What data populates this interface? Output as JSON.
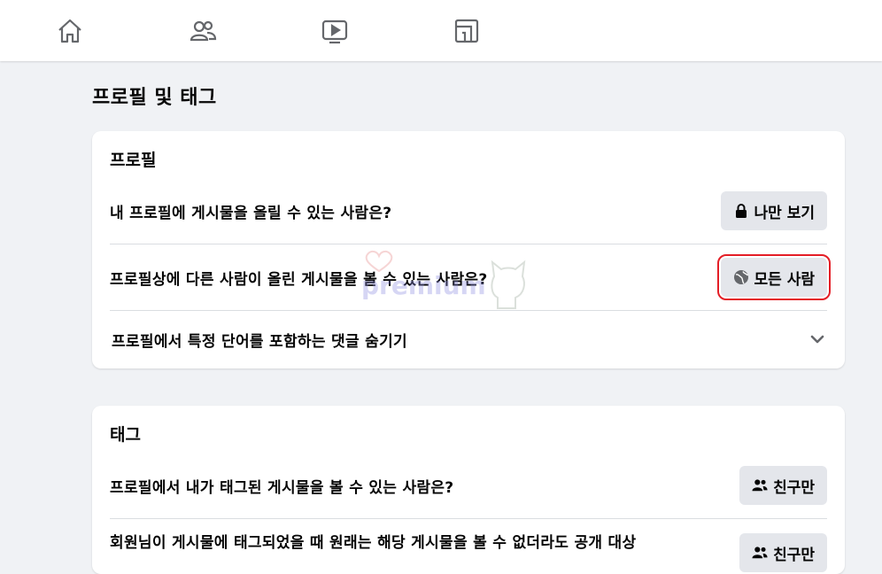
{
  "nav": {
    "items": [
      {
        "name": "home-icon"
      },
      {
        "name": "friends-icon"
      },
      {
        "name": "watch-icon"
      },
      {
        "name": "gaming-icon"
      }
    ]
  },
  "page": {
    "title": "프로필 및 태그"
  },
  "profile_card": {
    "title": "프로필",
    "rows": [
      {
        "label": "내 프로필에 게시물을 올릴 수 있는 사람은?",
        "button": "나만 보기",
        "icon": "lock-icon"
      },
      {
        "label": "프로필상에 다른 사람이 올린 게시물을 볼 수 있는 사람은?",
        "button": "모든 사람",
        "icon": "globe-icon"
      },
      {
        "label": "프로필에서 특정 단어를 포함하는 댓글 숨기기",
        "icon": "chevron-down-icon"
      }
    ]
  },
  "tag_card": {
    "title": "태그",
    "rows": [
      {
        "label": "프로필에서 내가 태그된 게시물을 볼 수 있는 사람은?",
        "button": "친구만",
        "icon": "friends-icon"
      },
      {
        "label": "회원님이 게시물에 태그되었을 때 원래는 해당 게시물을 볼 수 없더라도 공개 대상",
        "button": "친구만",
        "icon": "friends-icon"
      }
    ]
  },
  "watermark": {
    "text": "premium"
  },
  "colors": {
    "highlight": "#e41e26",
    "pill_bg": "#e4e6eb",
    "page_bg": "#f0f2f5"
  }
}
